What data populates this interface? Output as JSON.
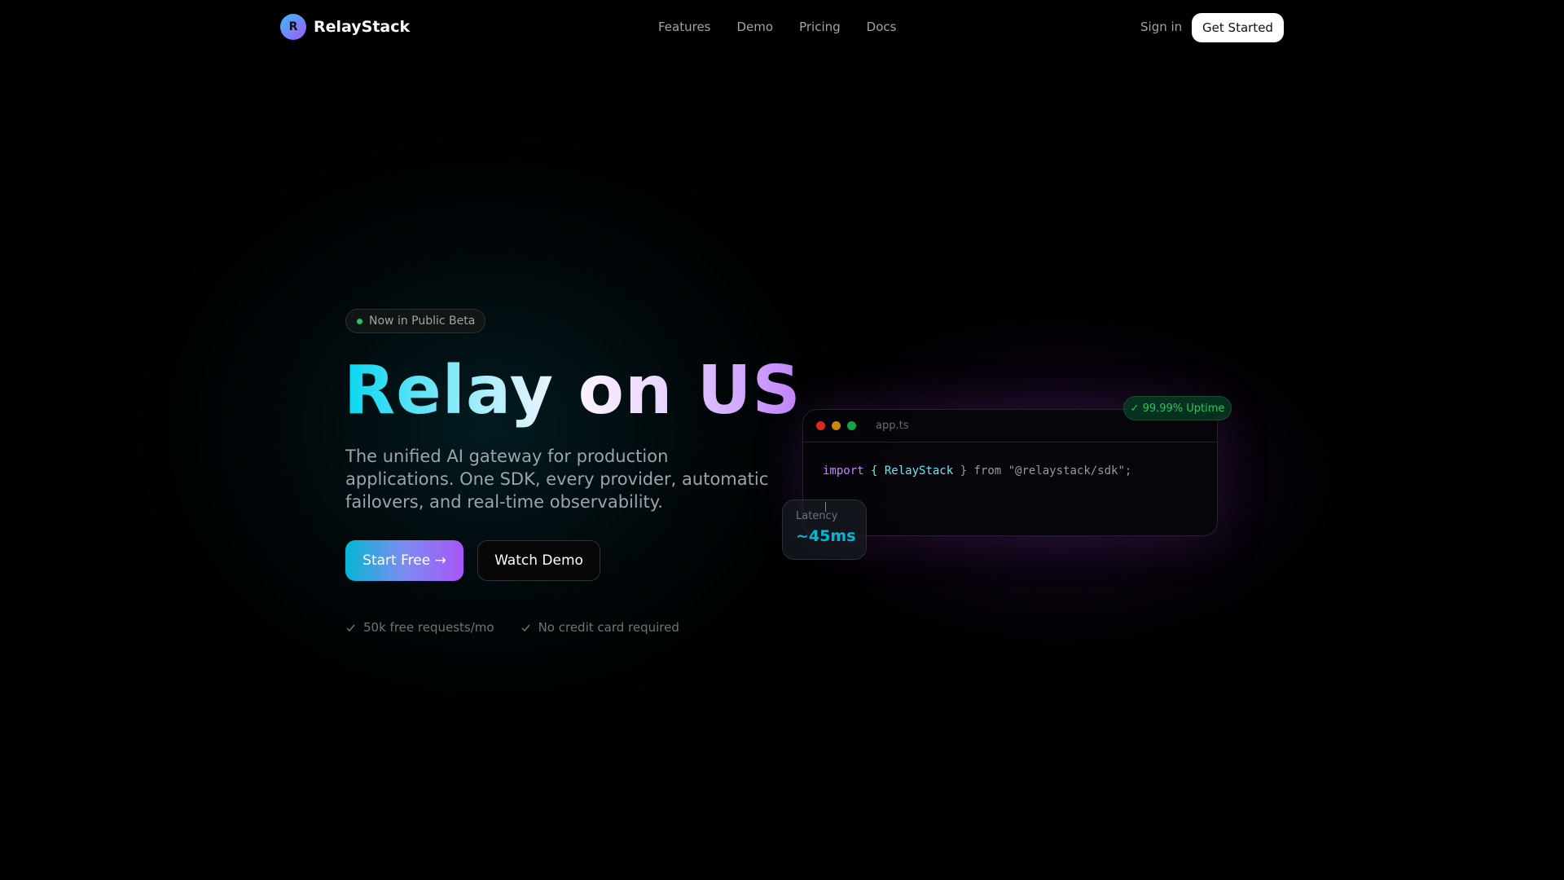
{
  "nav": {
    "logo_letter": "R",
    "brand": "RelayStack",
    "links": [
      "Features",
      "Demo",
      "Pricing",
      "Docs"
    ],
    "sign_in": "Sign in",
    "get_started": "Get Started"
  },
  "hero": {
    "badge": "Now in Public Beta",
    "title": "Relay on US",
    "description": "The unified AI gateway for production applications. One SDK, every provider, automatic failovers, and real-time observability.",
    "start_button": "Start Free →",
    "demo_button": "Watch Demo",
    "checks": [
      "50k free requests/mo",
      "No credit card required"
    ]
  },
  "code_window": {
    "filename": "app.ts",
    "code": {
      "kw": "import",
      "open": " { ",
      "ident": "RelayStack",
      "rest": " } from \"@relaystack/sdk\";"
    },
    "uptime": "✓ 99.99% Uptime",
    "latency_label": "Latency",
    "latency_value": "~45ms"
  },
  "colors": {
    "accent_cyan": "#06b6d4",
    "accent_purple": "#a855f7",
    "success": "#22c55e"
  }
}
